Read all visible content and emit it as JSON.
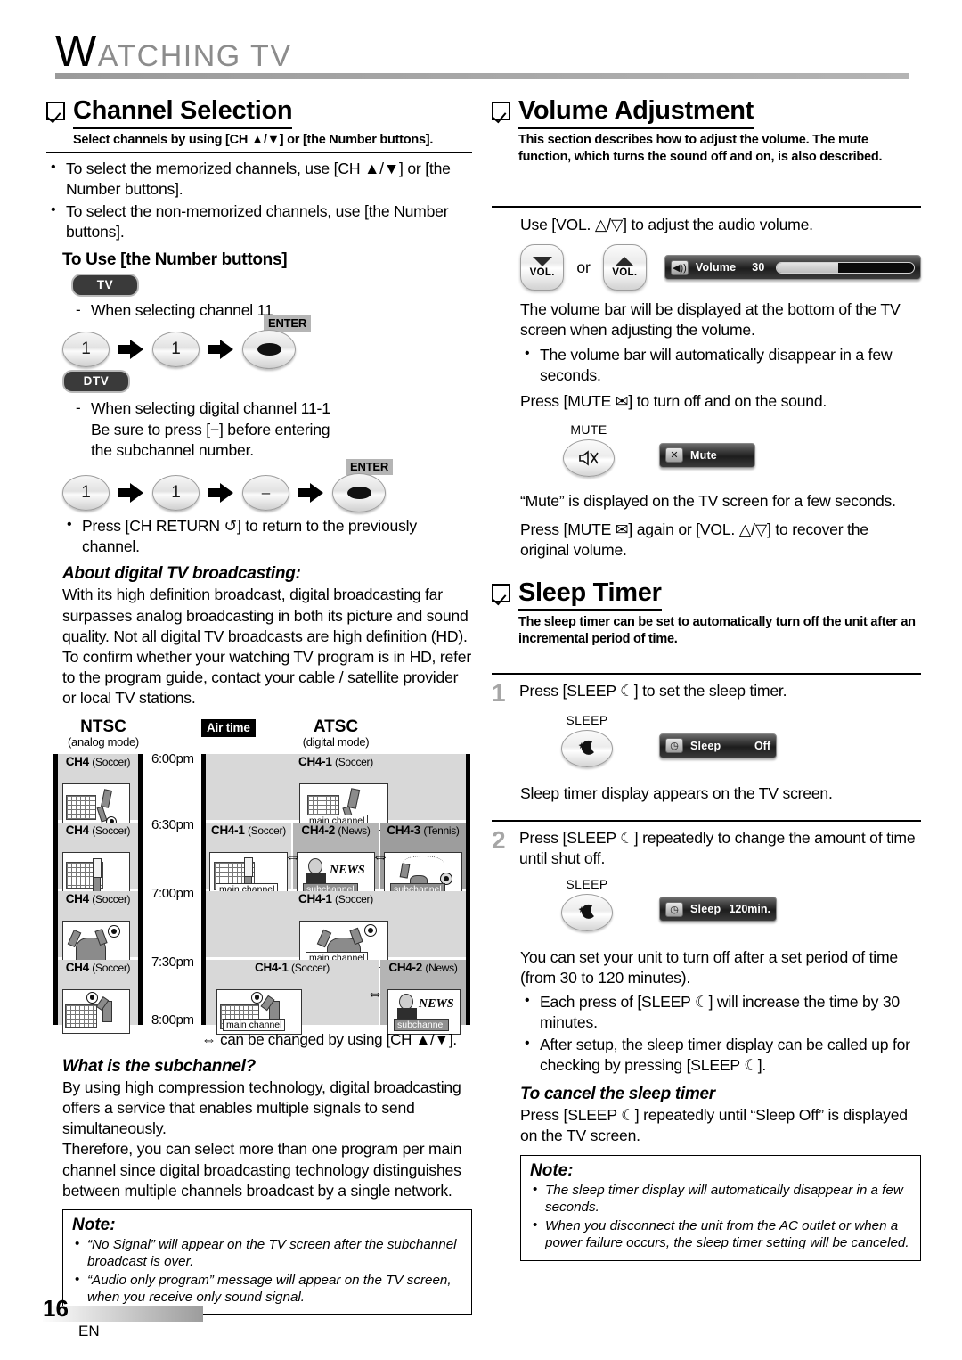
{
  "header": {
    "title_cap": "W",
    "title_rest": "ATCHING  TV"
  },
  "left": {
    "section": {
      "title": "Channel Selection",
      "subtitle": "Select channels by using [CH ▲/▼] or [the Number buttons]."
    },
    "bullets": [
      "To select the memorized channels, use [CH ▲/▼] or [the Number buttons].",
      "To select the non-memorized channels, use [the Number buttons]."
    ],
    "to_use_heading": "To Use [the Number buttons]",
    "badge_tv": "TV",
    "badge_dtv": "DTV",
    "dash1": "When selecting channel 11",
    "keys1": [
      "1",
      "1",
      "ENTER"
    ],
    "enter_label": "ENTER",
    "dash2_line1": "When selecting digital channel 11-1",
    "dash2_line2": "Be sure to press [−] before entering",
    "dash2_line3": "the subchannel number.",
    "keys2": [
      "1",
      "1",
      "–",
      "ENTER"
    ],
    "ch_return": "Press [CH RETURN ↺] to return to the previously channel.",
    "about_heading": "About digital TV broadcasting:",
    "about_body": "With its high definition broadcast, digital broadcasting far surpasses analog broadcasting in both its picture and sound quality. Not all digital TV broadcasts are high definition (HD). To confirm whether your watching TV program is in HD, refer to the program guide, contact your cable / satellite provider or local TV stations.",
    "diagram": {
      "ntsc_title": "NTSC",
      "ntsc_sub": "(analog mode)",
      "atsc_title": "ATSC",
      "atsc_sub": "(digital mode)",
      "air_time": "Air time",
      "times": [
        "6:00pm",
        "6:30pm",
        "7:00pm",
        "7:30pm",
        "8:00pm"
      ],
      "ntsc_cells": [
        {
          "ch": "CH4",
          "prog": "(Soccer)"
        },
        {
          "ch": "CH4",
          "prog": "(Soccer)"
        },
        {
          "ch": "CH4",
          "prog": "(Soccer)"
        },
        {
          "ch": "CH4",
          "prog": "(Soccer)"
        }
      ],
      "atsc_rows": [
        {
          "cells": [
            {
              "ch": "CH4-1",
              "prog": "(Soccer)",
              "tag": "main channel"
            }
          ]
        },
        {
          "cells": [
            {
              "ch": "CH4-1",
              "prog": "(Soccer)",
              "tag": "main channel"
            },
            {
              "ch": "CH4-2",
              "prog": "(News)",
              "tag": "subchannel"
            },
            {
              "ch": "CH4-3",
              "prog": "(Tennis)",
              "tag": "subchannel"
            }
          ]
        },
        {
          "cells": [
            {
              "ch": "CH4-1",
              "prog": "(Soccer)",
              "tag": "main channel"
            }
          ]
        },
        {
          "cells": [
            {
              "ch": "CH4-1",
              "prog": "(Soccer)",
              "tag": "main channel"
            },
            {
              "ch": "CH4-2",
              "prog": "(News)",
              "tag": "subchannel"
            }
          ]
        }
      ],
      "news_word": "NEWS",
      "caption": "⇔ can be changed by using [CH ▲/▼]."
    },
    "subchannel_heading": "What is the subchannel?",
    "subchannel_p1": "By using high compression technology, digital broadcasting offers a service that enables multiple signals to send simultaneously.",
    "subchannel_p2": "Therefore, you can select more than one program per main channel since digital broadcasting technology distinguishes between multiple channels broadcast by a single network.",
    "note": {
      "title": "Note:",
      "items": [
        "“No Signal” will appear on the TV screen after the subchannel broadcast is over.",
        "“Audio only program” message will appear on the TV screen, when you receive only sound signal."
      ]
    }
  },
  "right": {
    "volume": {
      "title": "Volume Adjustment",
      "subtitle": "This section describes how to adjust the volume. The mute function, which turns the sound off and on, is also described.",
      "use_line": "Use [VOL. △/▽] to adjust the audio volume.",
      "key_down_label": "VOL.",
      "key_up_label": "VOL.",
      "or_label": "or",
      "osd": {
        "icon": "speaker-icon",
        "name": "Volume",
        "value": "30",
        "fill_percent": 45
      },
      "body1": "The volume bar will be displayed at the bottom of the TV screen when adjusting the volume.",
      "bullet1": "The volume bar will automatically disappear in a few seconds.",
      "press_mute": "Press [MUTE ✉] to turn off and on the sound.",
      "mute_key_label": "MUTE",
      "mute_osd": {
        "icon": "mute-icon",
        "name": "Mute"
      },
      "mute_note": "“Mute” is displayed on the TV screen for a few seconds.",
      "recover": "Press [MUTE ✉] again or [VOL. △/▽] to recover the original volume."
    },
    "sleep": {
      "title": "Sleep Timer",
      "subtitle": "The sleep timer can be set to automatically turn off the unit after an incremental period of time.",
      "step1_num": "1",
      "step1_text": "Press [SLEEP ☾] to set the sleep timer.",
      "sleep_key_label": "SLEEP",
      "osd1": {
        "icon": "clock-icon",
        "name": "Sleep",
        "value": "Off"
      },
      "step1_after": "Sleep timer display appears on the TV screen.",
      "step2_num": "2",
      "step2_text": "Press [SLEEP ☾] repeatedly to change the amount of time until shut off.",
      "osd2": {
        "icon": "clock-icon",
        "name": "Sleep",
        "value": "120min."
      },
      "step2_body": "You can set your unit to turn off after a set period of time (from 30 to 120 minutes).",
      "step2_bullets": [
        "Each press of [SLEEP ☾] will increase the time by 30 minutes.",
        "After setup, the sleep timer display can be called up for checking by pressing [SLEEP ☾]."
      ],
      "cancel_heading": "To cancel the sleep timer",
      "cancel_body": "Press [SLEEP ☾] repeatedly until “Sleep Off” is displayed on the TV screen.",
      "note": {
        "title": "Note:",
        "items": [
          "The sleep timer display will automatically disappear in a few seconds.",
          "When you disconnect the unit from the AC outlet or when a power failure occurs, the sleep timer setting will be canceled."
        ]
      }
    }
  },
  "footer": {
    "page_number": "16",
    "language": "EN"
  }
}
